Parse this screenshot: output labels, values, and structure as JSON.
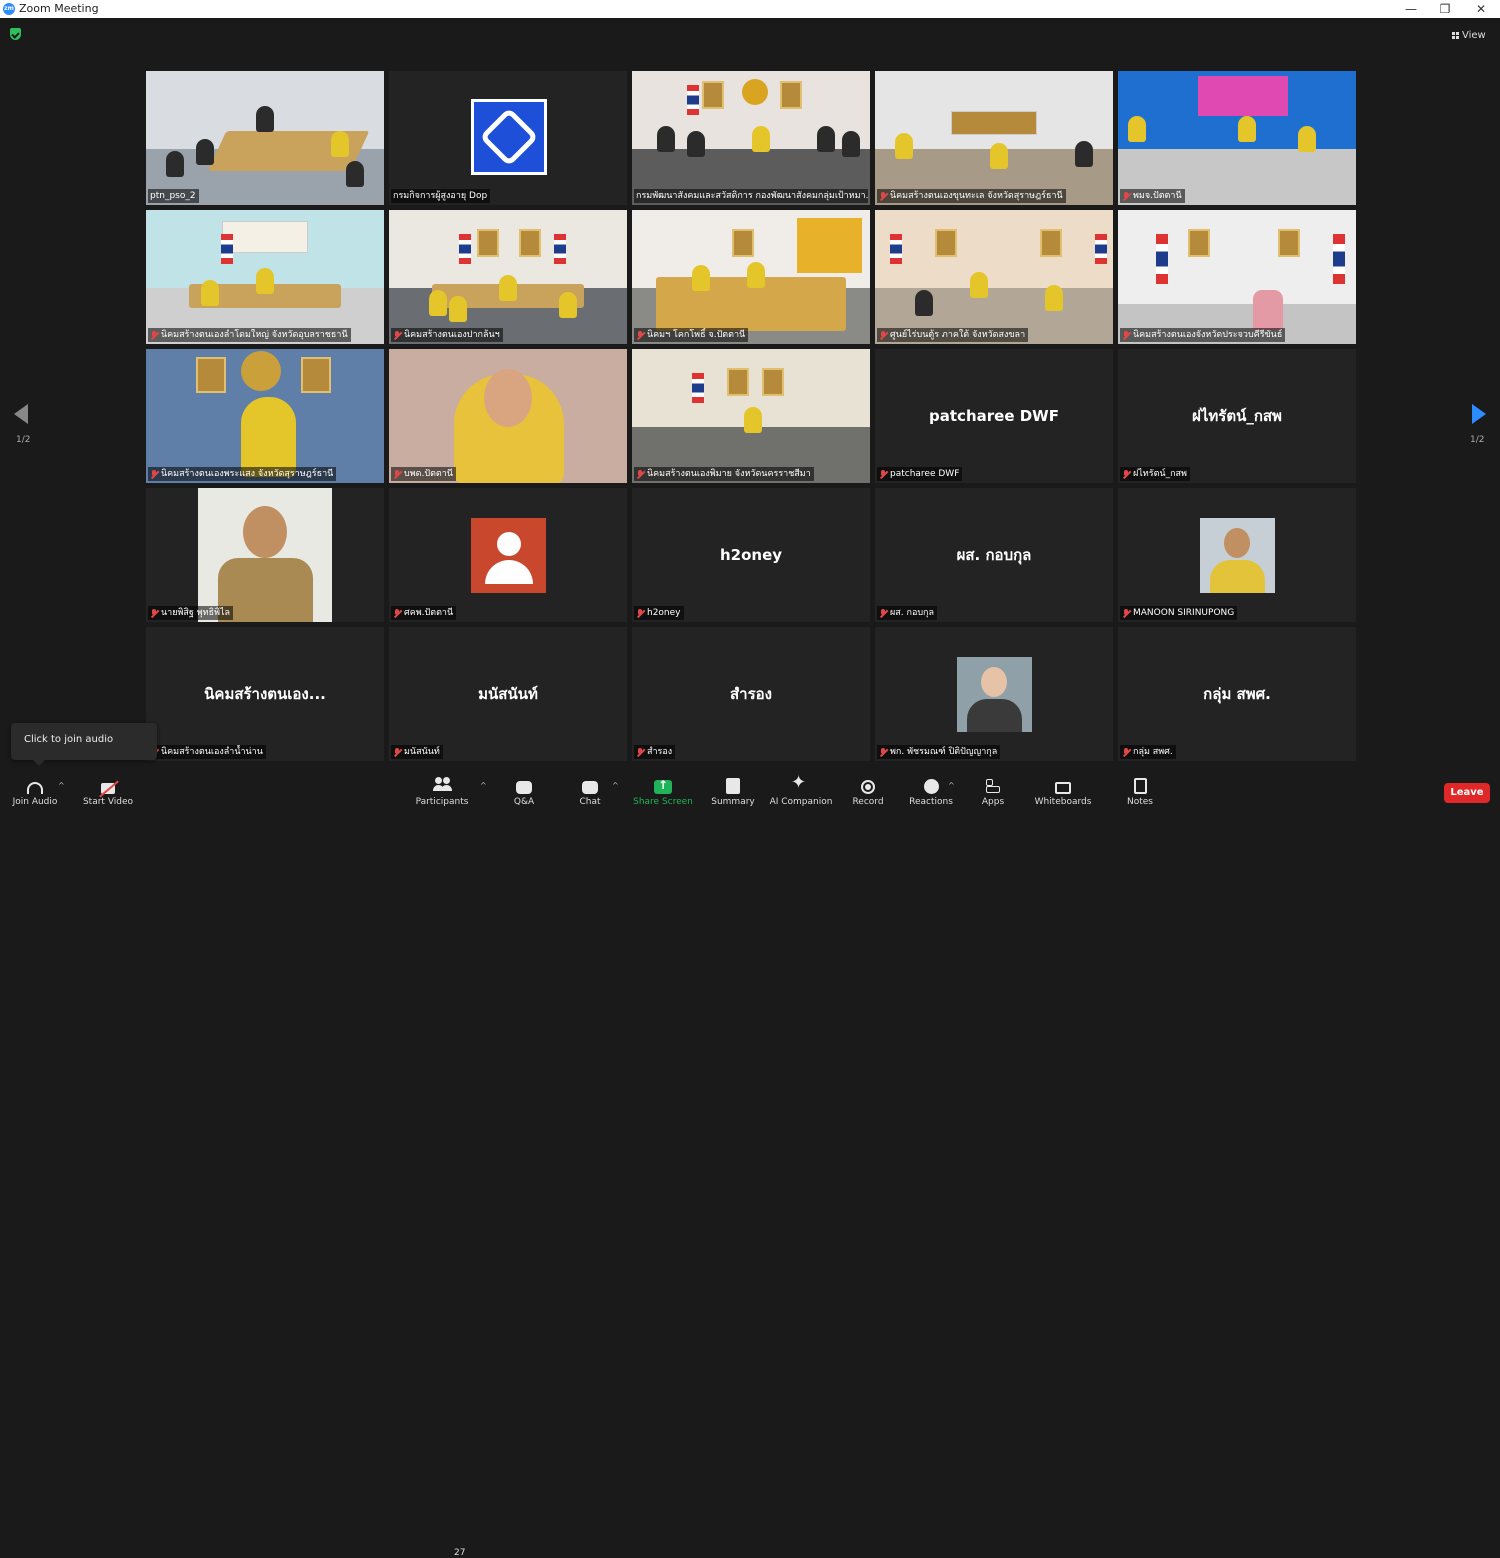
{
  "window": {
    "title": "Zoom Meeting",
    "logo_text": "zm",
    "minimize": "—",
    "restore": "❐",
    "close": "✕"
  },
  "view_button": {
    "label": "View"
  },
  "pagination": {
    "left": "1/2",
    "right": "1/2"
  },
  "tiles": [
    {
      "name": "ptn_pso_2",
      "muted": false,
      "kind": "video"
    },
    {
      "name": "กรมกิจการผู้สูงอายุ Dop",
      "muted": false,
      "kind": "logo"
    },
    {
      "name": "กรมพัฒนาสังคมและสวัสดิการ กองพัฒนาสังคมกลุ่มเป้าหมา...",
      "muted": false,
      "kind": "video",
      "active": true
    },
    {
      "name": "นิคมสร้างตนเองขุนทะเล จังหวัดสุราษฎร์ธานี",
      "muted": true,
      "kind": "video"
    },
    {
      "name": "พมจ.ปัตตานี",
      "muted": true,
      "kind": "video"
    },
    {
      "name": "นิคมสร้างตนเองลำโดมใหญ่ จังหวัดอุบลราชธานี",
      "muted": true,
      "kind": "video"
    },
    {
      "name": "นิคมสร้างตนเองปากล้นฯ",
      "muted": true,
      "kind": "video"
    },
    {
      "name": "นิคมฯ โคกโพธิ์ จ.ปัตตานี",
      "muted": true,
      "kind": "video"
    },
    {
      "name": "ศูนย์ไร่บนตู้ร ภาคใต้ จังหวัดสงขลา",
      "muted": true,
      "kind": "video"
    },
    {
      "name": "นิคมสร้างตนเองจังหวัดประจวบคีรีขันธ์",
      "muted": true,
      "kind": "video"
    },
    {
      "name": "นิคมสร้างตนเองพระแสง จังหวัดสุราษฎร์ธานี",
      "muted": true,
      "kind": "video"
    },
    {
      "name": "บพด.ปัตตานี",
      "muted": true,
      "kind": "video"
    },
    {
      "name": "นิคมสร้างตนเองพิมาย จังหวัดนครราชสีมา",
      "muted": true,
      "kind": "video"
    },
    {
      "name": "patcharee DWF",
      "muted": true,
      "kind": "text",
      "display": "patcharee DWF"
    },
    {
      "name": "ฝไทรัตน์_กสพ",
      "muted": true,
      "kind": "text",
      "display": "ฝไทรัตน์_กสพ"
    },
    {
      "name": "นายพิสิฐ พุทธิพิไล",
      "muted": true,
      "kind": "photo-large"
    },
    {
      "name": "ศคพ.ปัตตานี",
      "muted": true,
      "kind": "avatar"
    },
    {
      "name": "h2oney",
      "muted": true,
      "kind": "text",
      "display": "h2oney"
    },
    {
      "name": "ผส. กอบกุล",
      "muted": true,
      "kind": "text",
      "display": "ผส. กอบกุล"
    },
    {
      "name": "MANOON SIRINUPONG",
      "muted": true,
      "kind": "photo"
    },
    {
      "name": "นิคมสร้างตนเองลำน้ำน่าน",
      "muted": true,
      "kind": "text",
      "display": "นิคมสร้างตนเอง..."
    },
    {
      "name": "มนัสนันท์",
      "muted": true,
      "kind": "text",
      "display": "มนัสนันท์"
    },
    {
      "name": "สำรอง",
      "muted": true,
      "kind": "text",
      "display": "สำรอง"
    },
    {
      "name": "พก. พัชรมณฑ์ ปิติปัญญากุล",
      "muted": true,
      "kind": "photo"
    },
    {
      "name": "กลุ่ม สพศ.",
      "muted": true,
      "kind": "text",
      "display": "กลุ่ม สพศ."
    }
  ],
  "tooltip": {
    "text": "Click to join audio"
  },
  "toolbar": {
    "join_audio": "Join Audio",
    "start_video": "Start Video",
    "participants": "Participants",
    "participants_count": "27",
    "qa": "Q&A",
    "chat": "Chat",
    "share_screen": "Share Screen",
    "summary": "Summary",
    "ai_companion": "AI Companion",
    "record": "Record",
    "reactions": "Reactions",
    "apps": "Apps",
    "whiteboards": "Whiteboards",
    "notes": "Notes",
    "leave": "Leave",
    "caret": "^"
  },
  "colors": {
    "background": "#1a1a1a",
    "tile": "#232323",
    "active_border": "#c6e84a",
    "share_green": "#1fb45a",
    "leave_red": "#e02828",
    "accent_blue": "#2d8cff"
  }
}
